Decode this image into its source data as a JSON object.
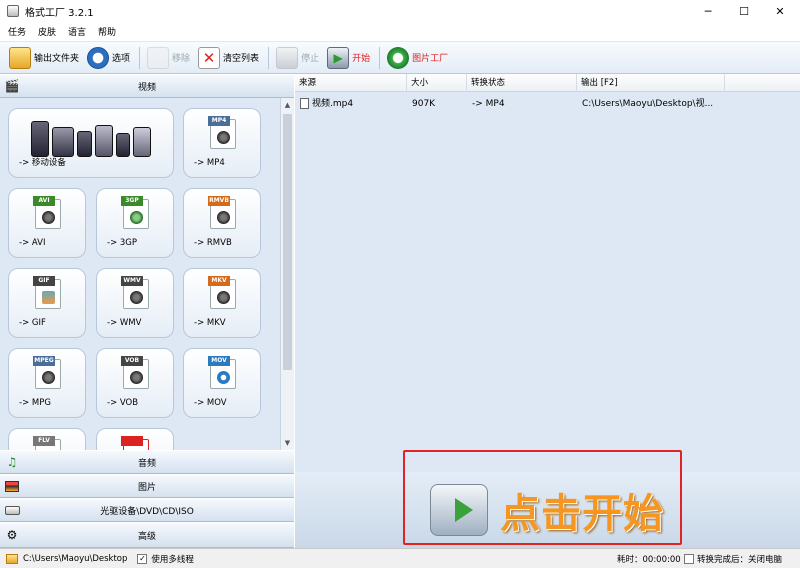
{
  "window": {
    "title": "格式工厂 3.2.1",
    "minimize": "─",
    "maximize": "☐",
    "close": "✕"
  },
  "menu": [
    "任务",
    "皮肤",
    "语言",
    "帮助"
  ],
  "toolbar": {
    "output_folder": "输出文件夹",
    "options": "选项",
    "remove": "移除",
    "clear_list": "清空列表",
    "stop": "停止",
    "start": "开始",
    "picture_factory": "图片工厂"
  },
  "sections": {
    "video": "视频",
    "audio": "音频",
    "picture": "图片",
    "disc": "光驱设备\\DVD\\CD\\ISO",
    "advanced": "高级"
  },
  "tiles": [
    {
      "label": "-> 移动设备"
    },
    {
      "label": "-> MP4",
      "tag": "MP4",
      "color": "#4a6e9a"
    },
    {
      "label": "-> AVI",
      "tag": "AVI",
      "color": "#3a8a2a"
    },
    {
      "label": "-> 3GP",
      "tag": "3GP",
      "color": "#3a8a2a"
    },
    {
      "label": "-> RMVB",
      "tag": "RMVB",
      "color": "#d46a1a"
    },
    {
      "label": "-> GIF",
      "tag": "GIF",
      "color": "#444"
    },
    {
      "label": "-> WMV",
      "tag": "WMV",
      "color": "#444"
    },
    {
      "label": "-> MKV",
      "tag": "MKV",
      "color": "#d46a1a"
    },
    {
      "label": "-> MPG",
      "tag": "MPEG",
      "color": "#4a6e9a"
    },
    {
      "label": "-> VOB",
      "tag": "VOB",
      "color": "#444"
    },
    {
      "label": "-> MOV",
      "tag": "MOV",
      "color": "#2a7ac0"
    },
    {
      "label": "",
      "tag": "FLV",
      "color": "#777"
    },
    {
      "label": "",
      "tag": "",
      "color": "#d22"
    }
  ],
  "table": {
    "headers": [
      "来源",
      "大小",
      "转换状态",
      "输出 [F2]"
    ],
    "rows": [
      {
        "source": "视频.mp4",
        "size": "907K",
        "status": "-> MP4",
        "output": "C:\\Users\\Maoyu\\Desktop\\视..."
      }
    ]
  },
  "start_big": "点击开始",
  "status": {
    "path": "C:\\Users\\Maoyu\\Desktop",
    "multithread": "使用多线程",
    "elapsed": "耗时：00:00:00",
    "after_done": "转换完成后：关闭电脑"
  },
  "colors": {
    "accent": "#f6951f",
    "highlight_box": "#e02424"
  }
}
